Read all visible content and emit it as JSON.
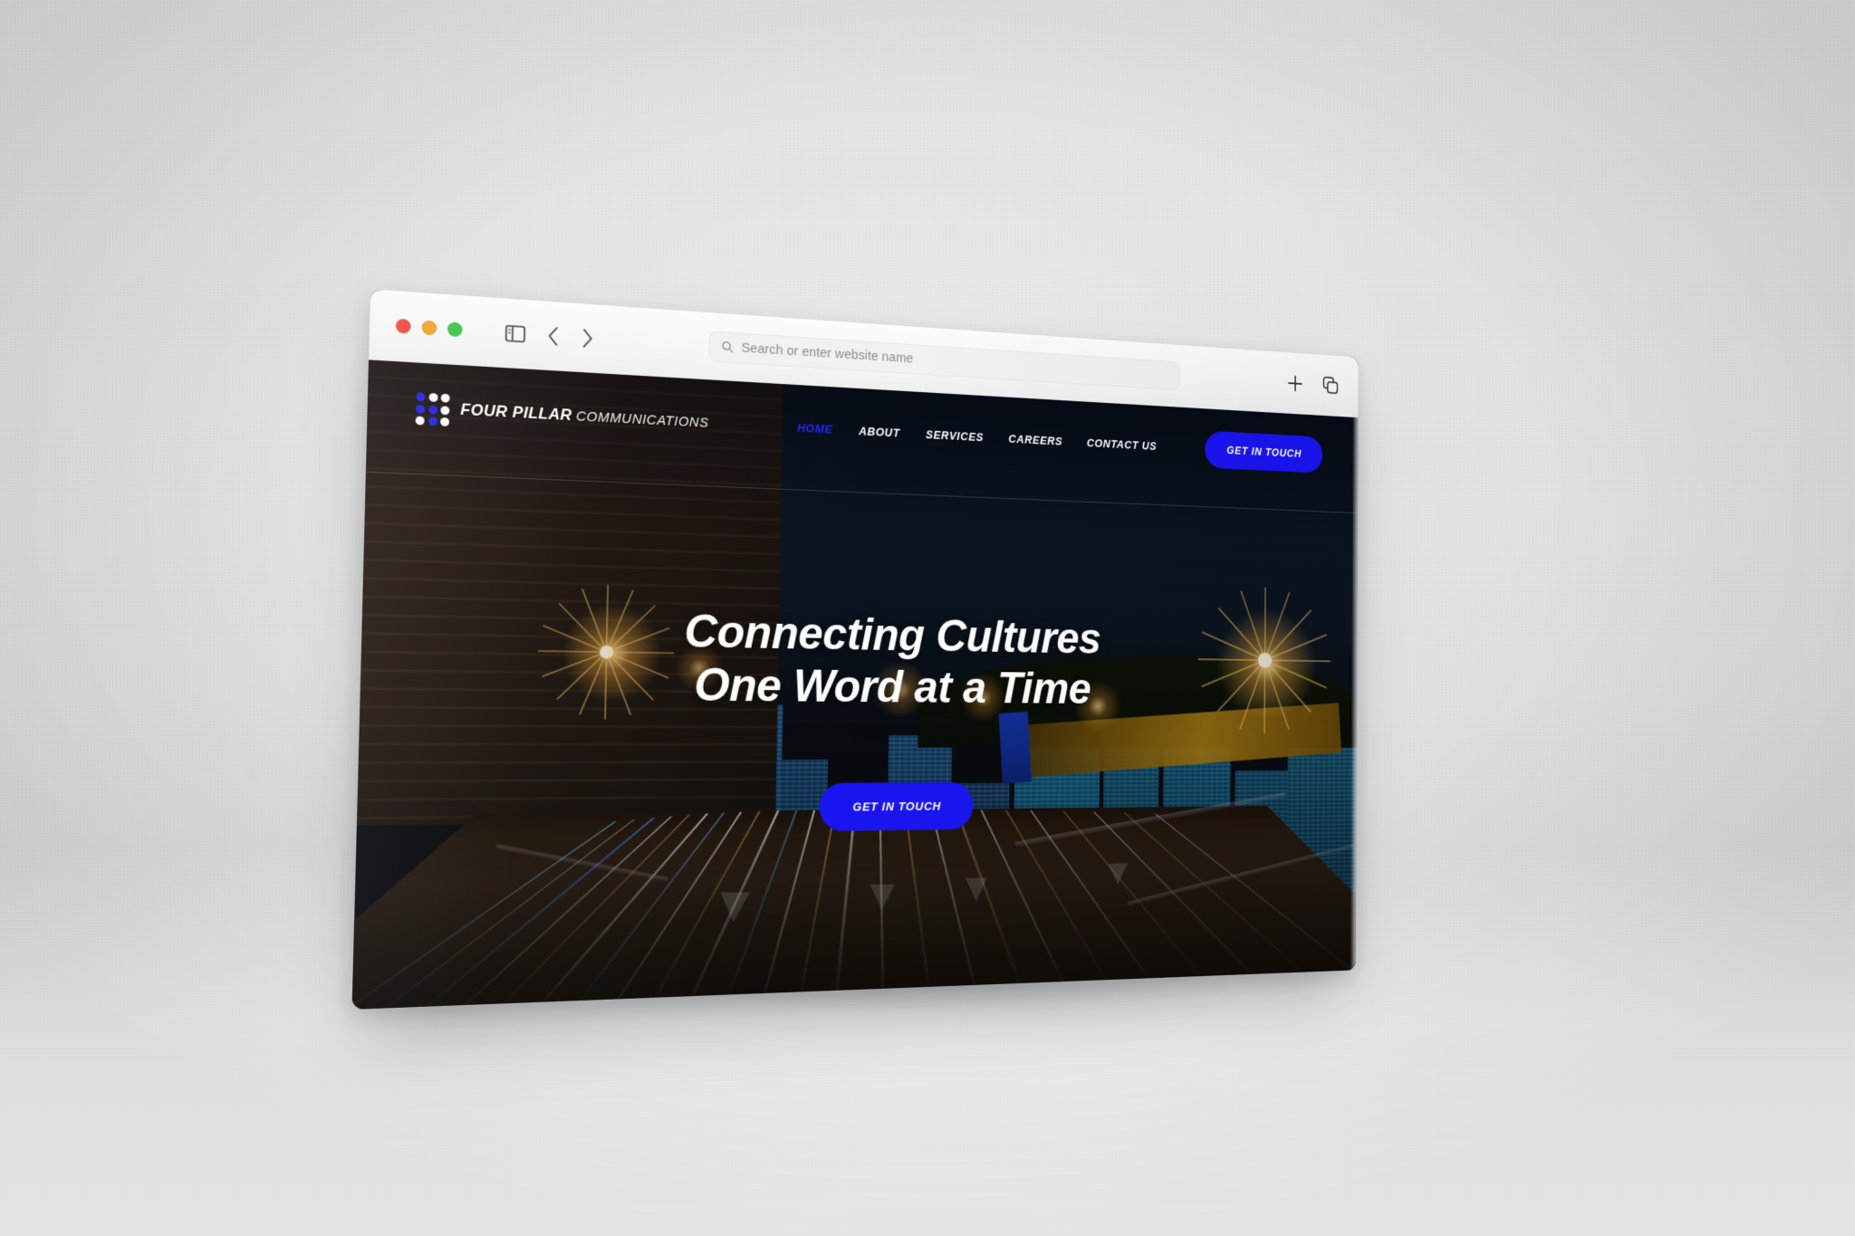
{
  "browser": {
    "traffic_lights": [
      "close",
      "minimize",
      "zoom"
    ],
    "sidebar_toggle_icon": "sidebar-icon",
    "back_icon": "chevron-left-icon",
    "forward_icon": "chevron-right-icon",
    "address_bar": {
      "icon": "search-icon",
      "value": "",
      "placeholder": "Search or enter website name"
    },
    "new_tab_icon": "plus-icon",
    "tab_overview_icon": "tabs-icon"
  },
  "site": {
    "logo": {
      "line1": "FOUR PILLAR",
      "line2": "COMMUNICATIONS",
      "mark_icon": "dot-grid-icon",
      "dots": [
        "b",
        "w",
        "w",
        "b",
        "b",
        "w",
        "w",
        "b",
        "w"
      ]
    },
    "nav": [
      {
        "label": "HOME",
        "active": true
      },
      {
        "label": "ABOUT",
        "active": false
      },
      {
        "label": "SERVICES",
        "active": false
      },
      {
        "label": "CAREERS",
        "active": false
      },
      {
        "label": "CONTACT US",
        "active": false
      }
    ],
    "header_cta": "GET IN TOUCH",
    "hero": {
      "title_line1": "Connecting Cultures",
      "title_line2": "One Word at a Time",
      "cta": "GET IN TOUCH",
      "background_description": "night-city-light-trails-photo"
    }
  },
  "colors": {
    "accent_blue": "#1a14f0",
    "nav_active": "#2323f5",
    "text_white": "#ffffff",
    "chrome_bg": "#f6f6f6",
    "backdrop": "#e4e5e5"
  }
}
